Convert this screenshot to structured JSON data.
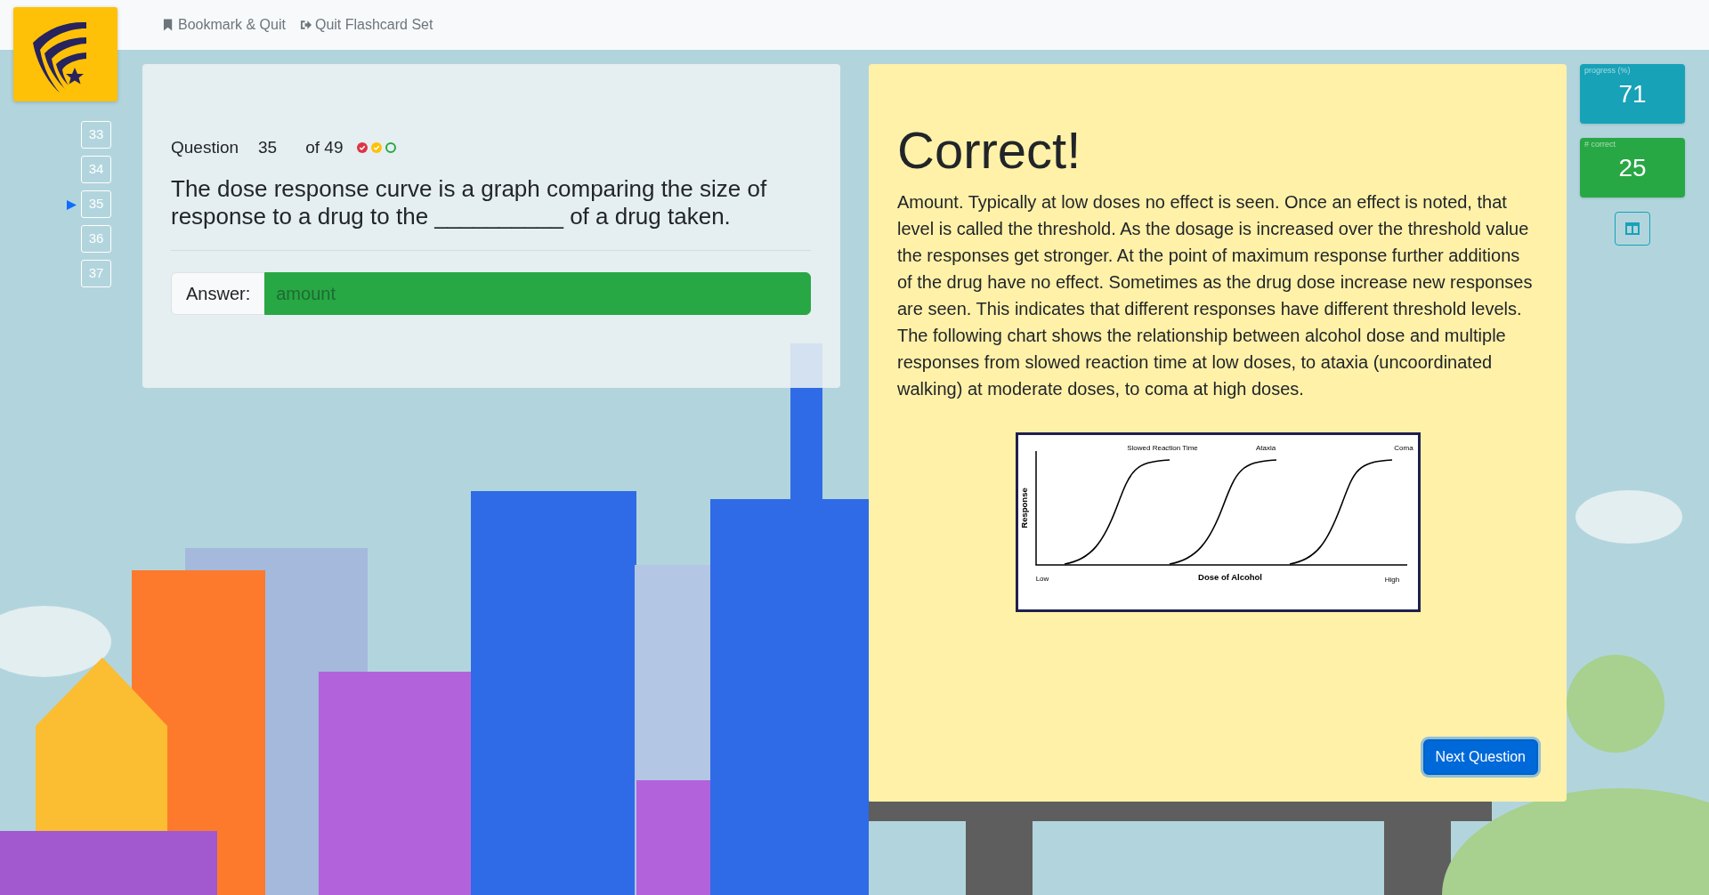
{
  "nav": {
    "links": [
      {
        "kind": "bookmark",
        "label": "Bookmark & Quit"
      },
      {
        "kind": "quit",
        "label": "Quit Flashcard Set"
      }
    ]
  },
  "question_list": [
    {
      "label": "33",
      "selected": false
    },
    {
      "label": "34",
      "selected": false
    },
    {
      "label": "35",
      "selected": true
    },
    {
      "label": "36",
      "selected": false
    },
    {
      "label": "37",
      "selected": false
    }
  ],
  "question": {
    "label": "Question",
    "number": "35",
    "of": "of 49",
    "attempts": [
      {
        "kind": "check",
        "color": "#dc3545"
      },
      {
        "kind": "check",
        "color": "#ffc107"
      },
      {
        "kind": "open",
        "color": "#28a745"
      }
    ],
    "text": "The dose response curve is a graph comparing the size of response to a drug to the __________ of a drug taken.",
    "answer_label": "Answer:",
    "answer": "amount"
  },
  "result": {
    "title": "Correct!",
    "explanation": "Amount. Typically at low doses no effect is seen. Once an effect is noted, that level is called the threshold. As the dosage is increased over the threshold value the responses get stronger. At the point of maximum response further additions of the drug have no effect. Sometimes as the drug dose increase new responses are seen. This indicates that different responses have different threshold levels. The following chart shows the relationship between alcohol dose and multiple responses from slowed reaction time at low doses, to ataxia (uncoordinated walking) at moderate doses, to coma at high doses.",
    "figure": {
      "curves": [
        "Slowed Reaction Time",
        "Ataxia",
        "Coma"
      ],
      "ylabel": "Response",
      "xlabel": "Dose of Alcohol",
      "x_low": "Low",
      "x_high": "High"
    },
    "next_button": "Next Question"
  },
  "stats": [
    {
      "label": "progress (%)",
      "value": "71",
      "color": "#17a2b8"
    },
    {
      "label": "# correct",
      "value": "25",
      "color": "#28a745"
    }
  ]
}
